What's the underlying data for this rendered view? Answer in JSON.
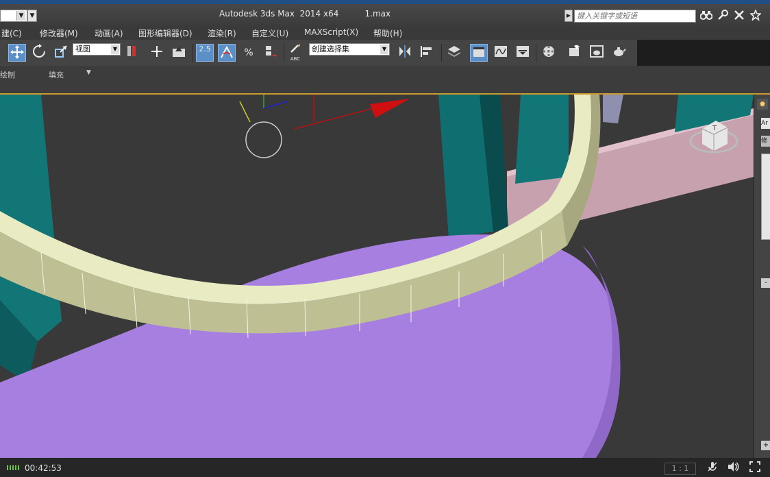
{
  "titlebar": {
    "title": "Autodesk 3ds Max  2014 x64          1.max",
    "search_placeholder": "键入关键字或短语",
    "qa_dropdown_arrow": "▼",
    "qa_button": "▼",
    "search_arrow": "▶",
    "icons": [
      "binoculars-icon",
      "key-icon",
      "satellite-icon",
      "star-icon"
    ]
  },
  "menubar": {
    "items": [
      "建(C)",
      "修改器(M)",
      "动画(A)",
      "图形编辑器(D)",
      "渲染(R)",
      "自定义(U)",
      "MAXScript(X)",
      "帮助(H)"
    ]
  },
  "toolbar": {
    "view_select": "视图",
    "selset_select": "创建选择集",
    "snap_label": "2.5",
    "percent_label": "%",
    "abc_label": "ABC",
    "dropdown_arrow": "▼"
  },
  "ribbon": {
    "tabs": [
      "绘制",
      "填充"
    ],
    "toggle": "▼"
  },
  "viewcube": {
    "face_label": "T"
  },
  "cmdpanel": {
    "label_1": "Ar",
    "label_2": "修"
  },
  "statusbar": {
    "time": "00:42:53",
    "ratio": "1 : 1"
  },
  "colors": {
    "accent_blue": "#5b8fc7",
    "ribbon_border": "#c99b2c",
    "floor_purple": "#a77fe0",
    "wall_cream": "#cfd1a3",
    "pillar_teal": "#137676",
    "beam_pink": "#d8aebc",
    "progress_green": "#6cc24a"
  }
}
